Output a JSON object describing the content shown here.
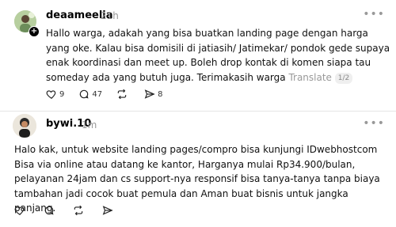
{
  "posts": [
    {
      "username": "deaameelia",
      "time": "21h",
      "text": "Hallo warga, adakah yang bisa buatkan landing page dengan harga yang oke. Kalau bisa domisili di jatiasih/ Jatimekar/ pondok gede supaya enak koordinasi dan meet up. Boleh drop kontak di komen siapa tau someday ada yang butuh juga. Terimakasih warga",
      "translate": "Translate",
      "page_indicator": "1/2",
      "likes": "9",
      "comments": "47",
      "reposts": "",
      "shares": "8"
    },
    {
      "username": "bywi.10",
      "time": "1m",
      "text": "Halo kak, untuk website landing pages/compro bisa kunjungi IDwebhostcom Bisa via online atau datang ke kantor, Harganya mulai Rp34.900/bulan, pelayanan 24jam dan cs support-nya responsif bisa tanya-tanya tanpa biaya tambahan jadi cocok buat pemula dan Aman buat bisnis untuk jangka panjang."
    }
  ],
  "icons": {
    "like": "heart-icon",
    "comment": "comment-icon",
    "repost": "repost-icon",
    "share": "share-icon",
    "more": "more-icon",
    "follow": "plus-icon"
  }
}
